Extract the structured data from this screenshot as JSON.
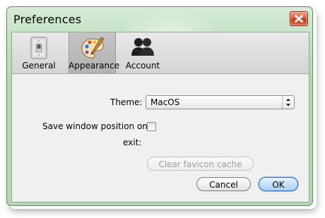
{
  "window": {
    "title": "Preferences"
  },
  "toolbar": {
    "items": [
      {
        "label": "General",
        "icon": "light-switch-icon"
      },
      {
        "label": "Appearance",
        "icon": "paint-palette-icon",
        "selected": true
      },
      {
        "label": "Account",
        "icon": "users-icon"
      }
    ]
  },
  "appearance": {
    "theme_label": "Theme:",
    "theme_value": "MacOS",
    "save_position_label_line1": "Save window position on",
    "save_position_label_line2": "exit:",
    "save_position_checked": false,
    "clear_favicon_label": "Clear favicon cache"
  },
  "buttons": {
    "cancel": "Cancel",
    "ok": "OK"
  },
  "colors": {
    "frame": "#c2e2c2",
    "close_button": "#d9573b",
    "ok_button": "#a9d1f7"
  }
}
